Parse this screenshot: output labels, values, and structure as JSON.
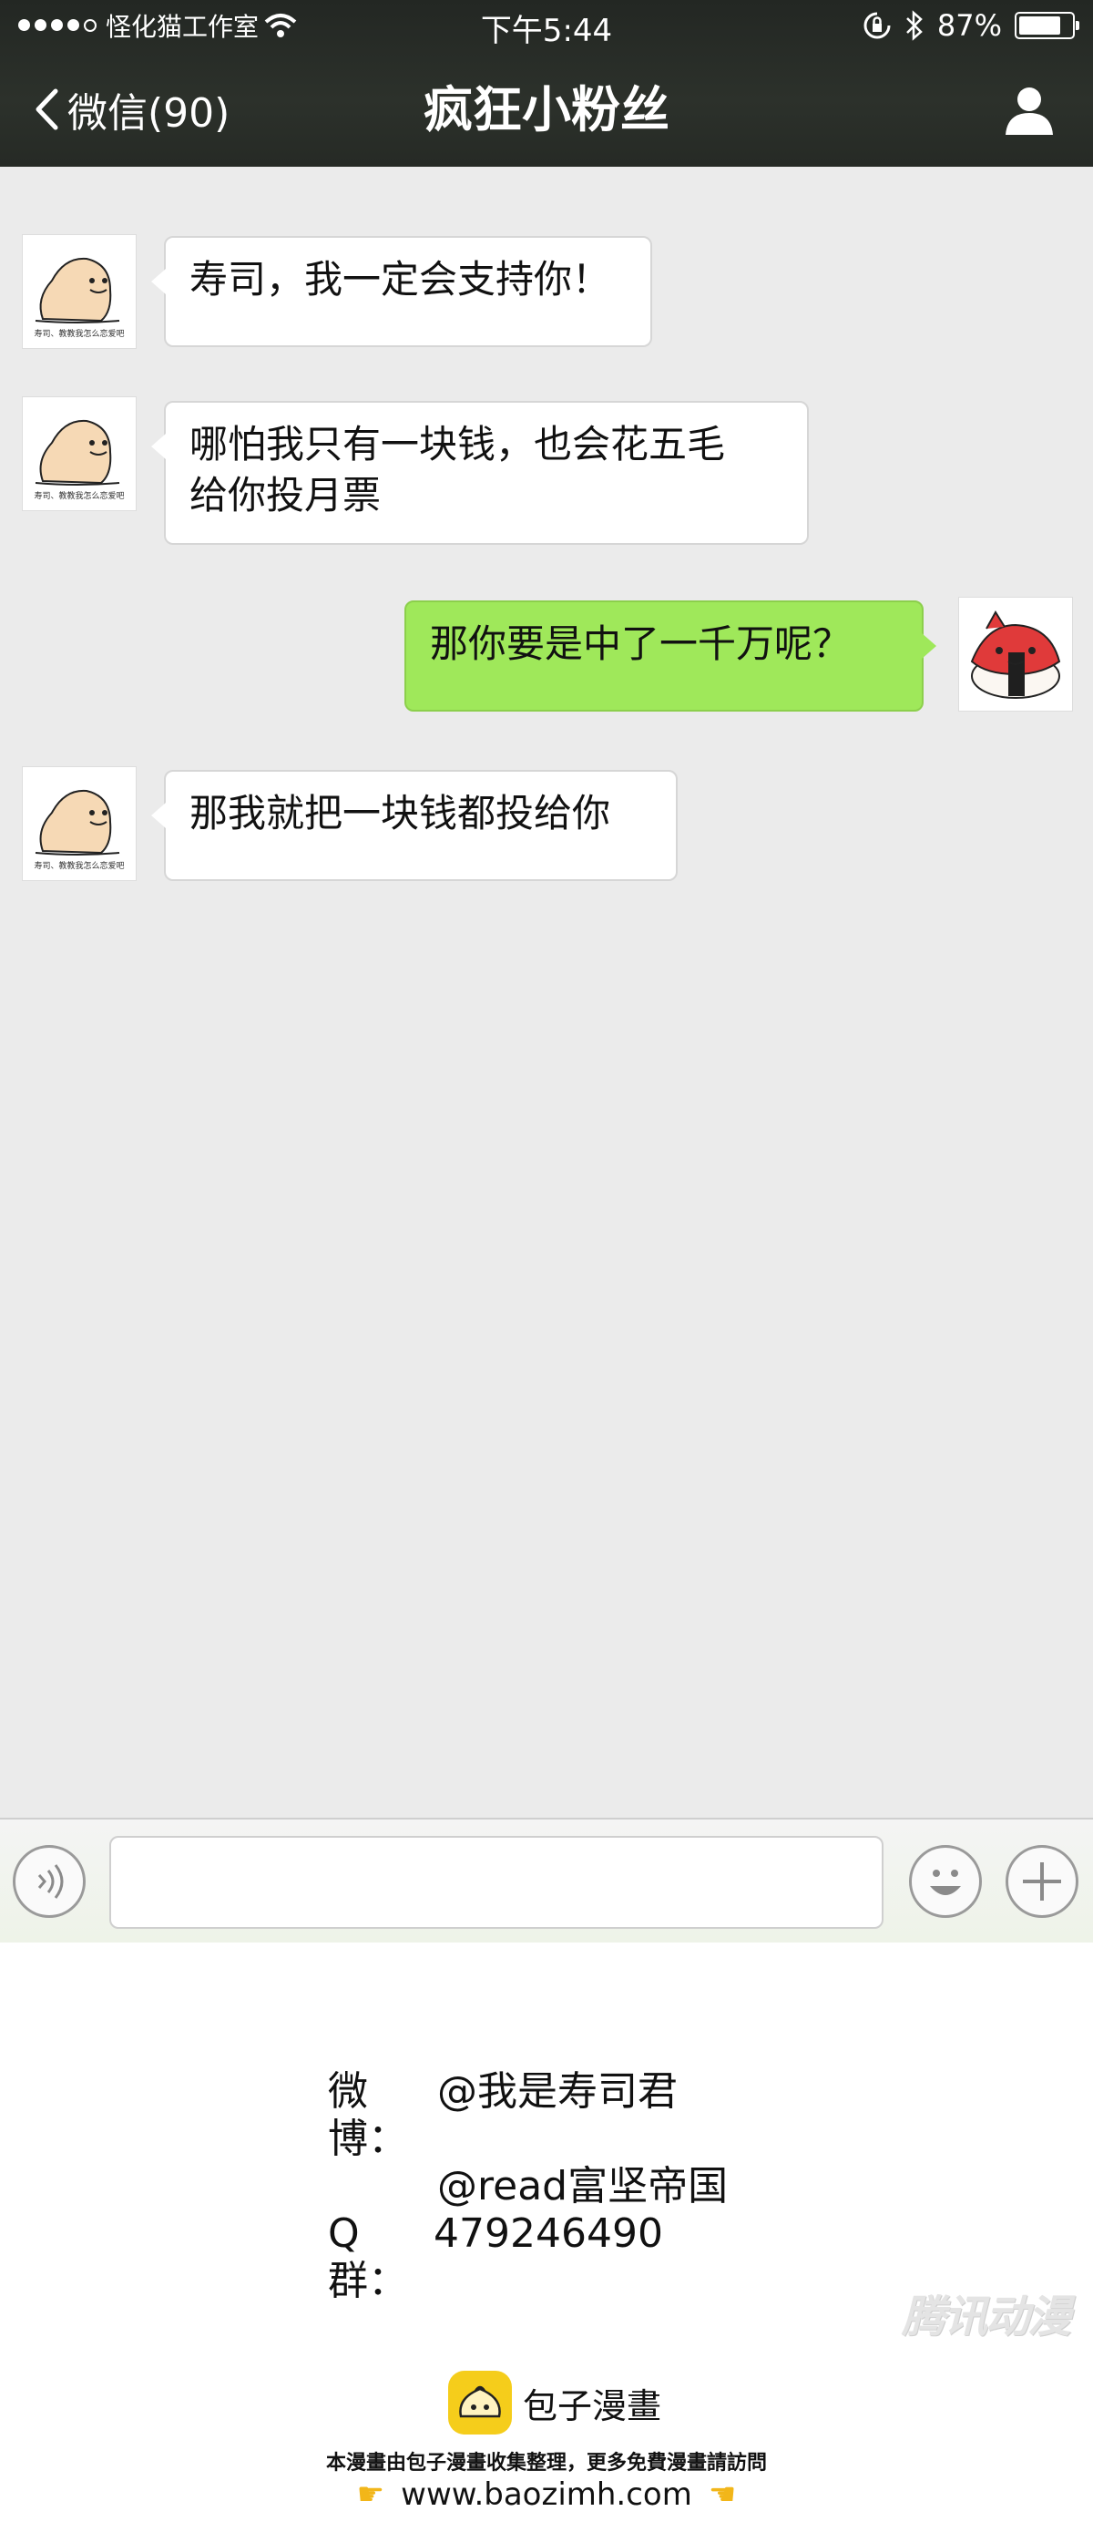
{
  "status_bar": {
    "carrier": "怪化猫工作室",
    "time": "下午5:44",
    "battery": "87%",
    "battery_level": 0.87
  },
  "nav": {
    "back_label": "微信(90)",
    "title": "疯狂小粉丝"
  },
  "avatar_caption": "寿司、教教我怎么恋爱吧",
  "messages": [
    {
      "side": "left",
      "lines": [
        "寿司，我一定会支持你！"
      ]
    },
    {
      "side": "left",
      "lines": [
        "哪怕我只有一块钱，也会花五毛",
        "给你投月票"
      ]
    },
    {
      "side": "right",
      "lines": [
        "那你要是中了一千万呢？"
      ]
    },
    {
      "side": "left",
      "lines": [
        "那我就把一块钱都投给你"
      ]
    }
  ],
  "input_bar": {
    "placeholder": ""
  },
  "credits": {
    "weibo_label": "微博：",
    "weibo_1": "@我是寿司君",
    "weibo_2": "@read富坚帝国",
    "qq_label": "Q群：",
    "qq_number": "479246490"
  },
  "watermark": "腾讯动漫",
  "footer": {
    "brand": "包子漫畫",
    "description": "本漫畫由包子漫畫收集整理，更多免費漫畫請訪問",
    "site": "www.baozimh.com"
  },
  "colors": {
    "nav_bg": "#2a2e29",
    "chat_bg": "#ebebeb",
    "my_bubble": "#9fe85a",
    "their_bubble": "#ffffff",
    "brand_yellow": "#f5cd1b"
  }
}
